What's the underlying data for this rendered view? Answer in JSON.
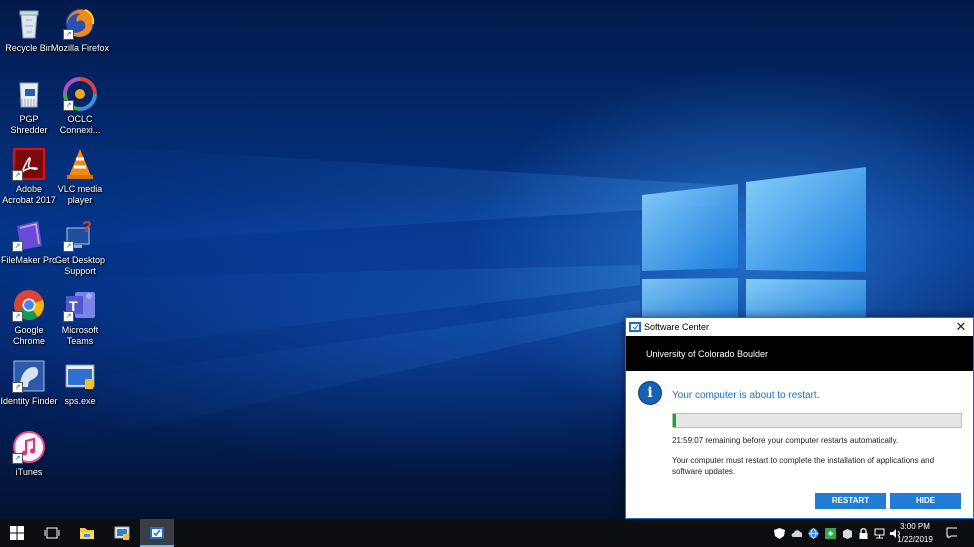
{
  "desktop": {
    "icons": [
      {
        "label": "Recycle Bin",
        "icon": "recycle-bin-icon"
      },
      {
        "label": "Mozilla Firefox",
        "icon": "firefox-icon"
      },
      {
        "label": "PGP Shredder",
        "icon": "pgp-shredder-icon"
      },
      {
        "label": "OCLC Connexi...",
        "icon": "oclc-connexion-icon"
      },
      {
        "label": "Adobe Acrobat 2017",
        "icon": "adobe-acrobat-icon"
      },
      {
        "label": "VLC media player",
        "icon": "vlc-icon"
      },
      {
        "label": "FileMaker Pro",
        "icon": "filemaker-icon"
      },
      {
        "label": "Get Desktop Support",
        "icon": "get-support-icon"
      },
      {
        "label": "Google Chrome",
        "icon": "chrome-icon"
      },
      {
        "label": "Microsoft Teams",
        "icon": "teams-icon"
      },
      {
        "label": "Identity Finder",
        "icon": "identity-finder-icon"
      },
      {
        "label": "sps.exe",
        "icon": "sps-exe-icon"
      },
      {
        "label": "iTunes",
        "icon": "itunes-icon"
      }
    ]
  },
  "dialog": {
    "title": "Software Center",
    "organization": "University of Colorado Boulder",
    "heading": "Your computer is about to restart.",
    "progress": 0.01,
    "remaining": "21:59:07 remaining before your computer restarts automatically.",
    "message": "Your computer must restart to complete the installation of applications and software updates.",
    "restart_label": "RESTART",
    "hide_label": "HIDE",
    "accent": "#1f7ed3"
  },
  "taskbar": {
    "buttons": [
      "start-icon",
      "task-view-icon",
      "file-explorer-icon",
      "app-icon",
      "software-center-icon"
    ],
    "tray": [
      "defender-icon",
      "onedrive-icon",
      "network-globe-icon",
      "green-app-icon",
      "box-icon",
      "lock-icon",
      "network-icon",
      "volume-icon"
    ],
    "time": "3:00 PM",
    "date": "1/22/2019"
  }
}
